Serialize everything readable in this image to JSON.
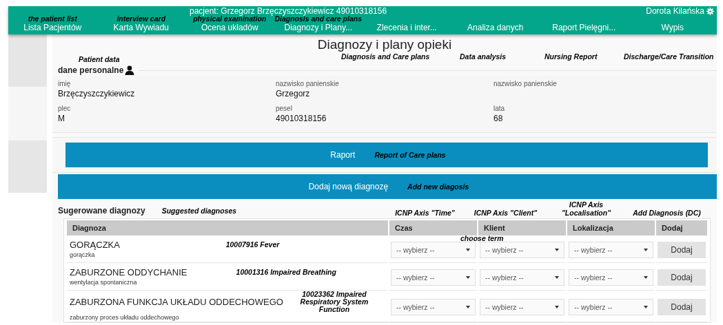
{
  "header": {
    "patient": "pacjent: Grzegorz Brzęczyszczykiewicz 49010318156",
    "user": "Dorota Kilańska",
    "nav": [
      {
        "label": "Lista Pacjentów",
        "note": "the patient list"
      },
      {
        "label": "Karta Wywiadu",
        "note": "interview card"
      },
      {
        "label": "Ocena układów",
        "note": "physical examination"
      },
      {
        "label": "Diagnozy i Plany...",
        "note": "Diagnosis and care plans"
      },
      {
        "label": "Zlecenia i inter..."
      },
      {
        "label": "Analiza danych"
      },
      {
        "label": "Raport Pielęgni..."
      },
      {
        "label": "Wypis"
      }
    ]
  },
  "page_title": "Diagnozy i plany opieki",
  "section_notes": [
    "Diagnosis and Care plans",
    "Data analysis",
    "Nursing Report",
    "Discharge/Care Transition"
  ],
  "personal": {
    "title": "dane personalne",
    "note": "Patient data",
    "fields": [
      {
        "label": "imię",
        "value": "Brzęczyszczykiewicz"
      },
      {
        "label": "nazwisko panienskie",
        "value": "Grzegorz"
      },
      {
        "label": "nazwisko panienskie"
      },
      {
        "label": "plec",
        "value": "M"
      },
      {
        "label": "pesel",
        "value": "49010318156"
      },
      {
        "label": "lata",
        "value": "68"
      }
    ]
  },
  "report_button": {
    "label": "Raport",
    "note": "Report of Care plans"
  },
  "add_button": {
    "label": "Dodaj nową diagnozę",
    "note": "Add new diagosis"
  },
  "suggested": {
    "title": "Sugerowane diagnozy",
    "note": "Suggested diagnoses",
    "choose_note": "choose term",
    "columns": [
      {
        "label": "Diagnoza"
      },
      {
        "label": "Czas",
        "note": "ICNP Axis \"Time\""
      },
      {
        "label": "Klient",
        "note": "ICNP Axis \"Client\""
      },
      {
        "label": "Lokalizacja",
        "note": "ICNP Axis \"Localisation\""
      },
      {
        "label": "Dodaj",
        "note": "Add Diagnosis (DC)"
      }
    ],
    "rows": [
      {
        "name": "GORĄCZKA",
        "detail": "gorączka",
        "note": "10007916 Fever",
        "selects": [
          "-- wybierz --",
          "-- wybierz --",
          "-- wybierz --"
        ],
        "button": "Dodaj"
      },
      {
        "name": "ZABURZONE ODDYCHANIE",
        "detail": "wentylacja spontaniczna",
        "note": "10001316 Impaired Breathing",
        "selects": [
          "-- wybierz --",
          "-- wybierz --",
          "-- wybierz --"
        ],
        "button": "Dodaj"
      },
      {
        "name": "ZABURZONA FUNKCJA UKŁADU ODDECHOWEGO",
        "detail": "zaburzony proces układu oddechowego",
        "note": "10023362 Impaired Respiratory System Function",
        "selects": [
          "-- wybierz --",
          "-- wybierz --",
          "-- wybierz --"
        ],
        "button": "Dodaj"
      }
    ]
  }
}
